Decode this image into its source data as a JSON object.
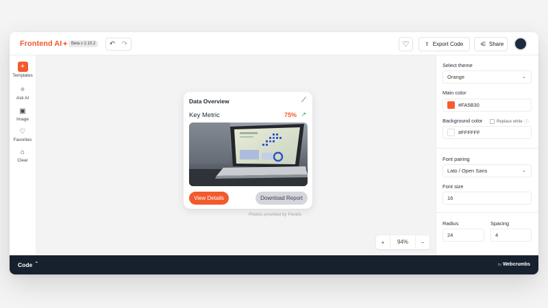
{
  "app": {
    "logo_text": "Frontend AI",
    "logo_spark": "✦",
    "version_badge": "Beta v 2.10.2"
  },
  "toolbar": {
    "undo_icon": "↶",
    "redo_icon": "↷",
    "heart_icon": "♡",
    "export_icon": "⇪",
    "export_label": "Export Code",
    "share_icon": "⋲",
    "share_label": "Share"
  },
  "sidebar": {
    "items": [
      {
        "icon": "+",
        "label": "Templates"
      },
      {
        "icon": "✧",
        "label": "Ask AI"
      },
      {
        "icon": "▣",
        "label": "Image"
      },
      {
        "icon": "♡",
        "label": "Favorites"
      },
      {
        "icon": "⌂",
        "label": "Clear"
      }
    ]
  },
  "preview_card": {
    "title": "Data Overview",
    "trend_icon": "⟋",
    "metric_label": "Key Metric",
    "metric_value": "75%",
    "metric_trend_icon": "↗",
    "primary_button": "View Details",
    "secondary_button": "Download Report"
  },
  "canvas": {
    "photo_credit": "Photos provided by Pexels",
    "zoom_minus": "−",
    "zoom_plus": "+",
    "zoom_value": "94%"
  },
  "settings": {
    "theme_label": "Select theme",
    "theme_value": "Orange",
    "main_color_label": "Main color",
    "main_color_value": "#FA5B30",
    "background_color_label": "Background color",
    "replace_white_label": "Replace white",
    "replace_info_icon": "ⓘ",
    "background_color_value": "#FFFFFF",
    "font_pairing_label": "Font pairing",
    "font_pairing_value": "Lato / Open Sans",
    "font_size_label": "Font size",
    "font_size_value": "16",
    "radius_label": "Radius",
    "radius_value": "24",
    "spacing_label": "Spacing",
    "spacing_value": "4",
    "chevron_icon": "⌄"
  },
  "bottom": {
    "code_label": "Code",
    "code_chevron": "⌃",
    "brand_by": "by",
    "brand_name": "Webcrumbs"
  },
  "colors": {
    "accent": "#F25A2E",
    "main_color": "#FA5B30",
    "background_color": "#FFFFFF",
    "positive": "#22A55A",
    "bottom_bar": "#17212E"
  }
}
